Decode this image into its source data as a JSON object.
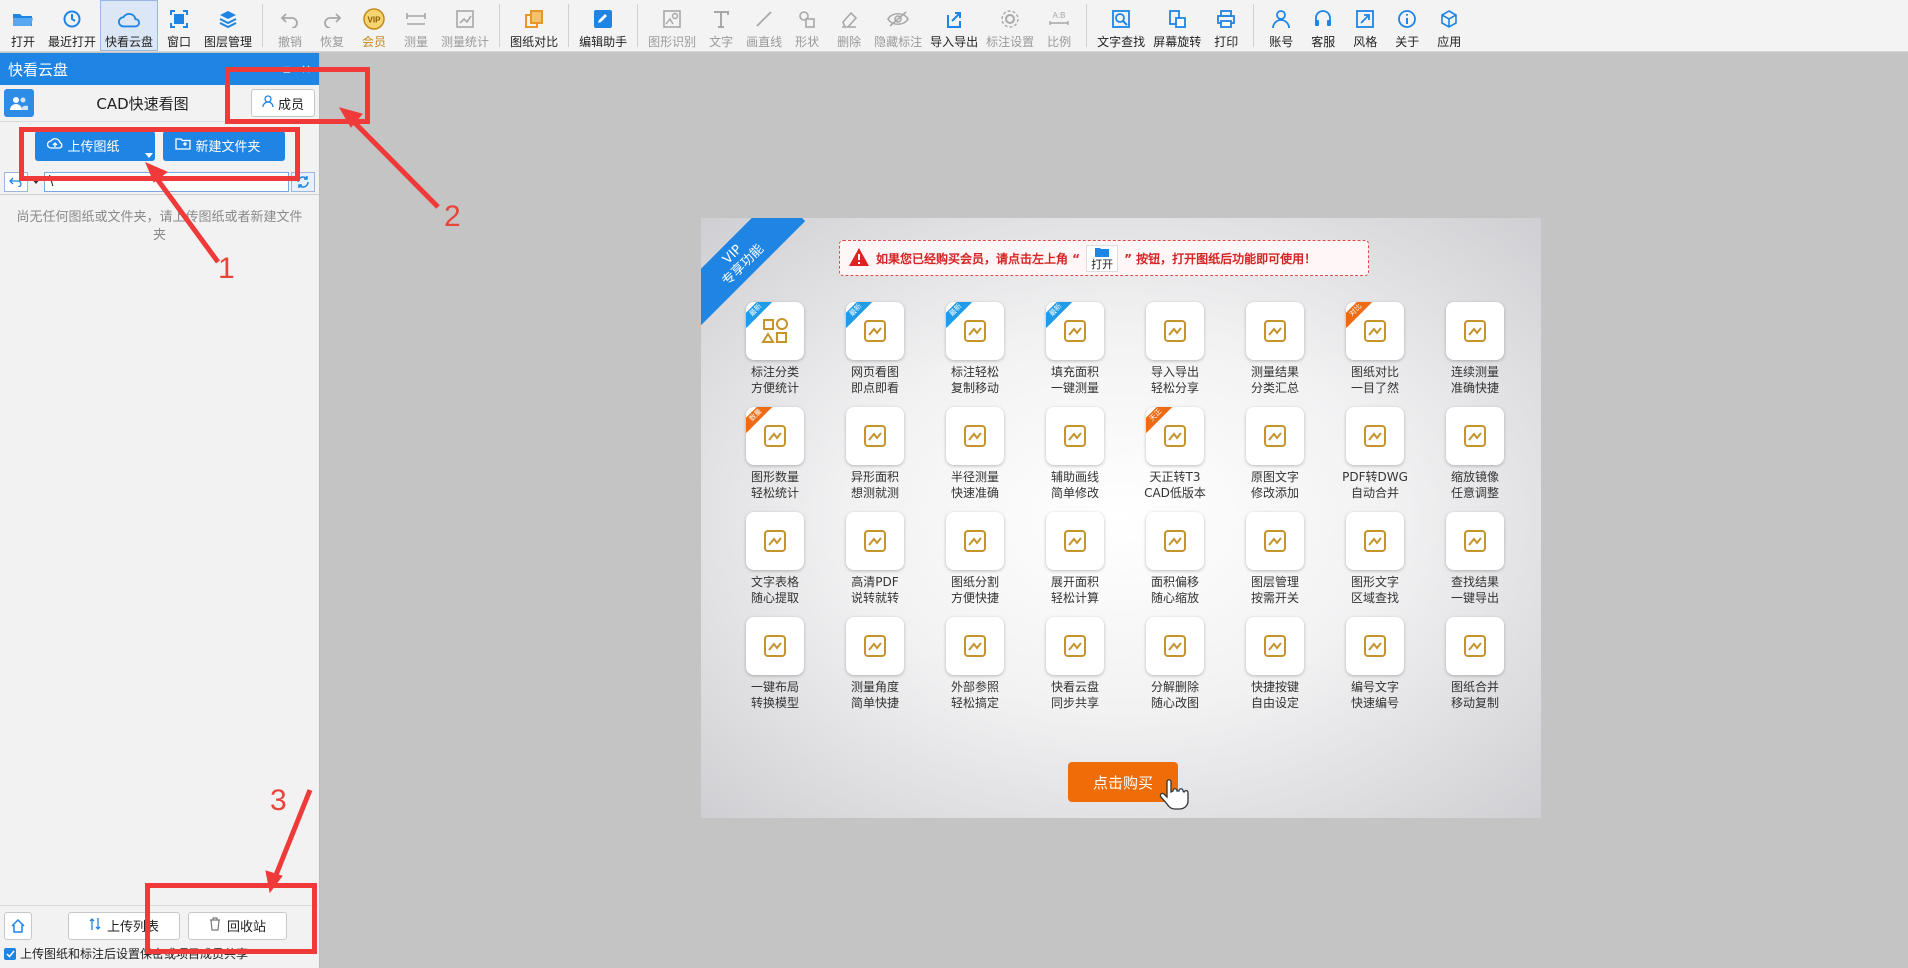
{
  "toolbar": {
    "items": [
      {
        "label": "打开",
        "icon": "open-folder-icon"
      },
      {
        "label": "最近打开",
        "icon": "recent-icon"
      },
      {
        "label": "快看云盘",
        "icon": "cloud-icon"
      },
      {
        "label": "窗口",
        "icon": "window-icon"
      },
      {
        "label": "图层管理",
        "icon": "layers-icon"
      },
      {
        "label": "撤销",
        "icon": "undo-icon"
      },
      {
        "label": "恢复",
        "icon": "redo-icon"
      },
      {
        "label": "会员",
        "icon": "vip-icon"
      },
      {
        "label": "测量",
        "icon": "measure-icon"
      },
      {
        "label": "测量统计",
        "icon": "measure-stats-icon"
      },
      {
        "label": "图纸对比",
        "icon": "compare-icon"
      },
      {
        "label": "编辑助手",
        "icon": "edit-assistant-icon"
      },
      {
        "label": "图形识别",
        "icon": "shape-recognize-icon"
      },
      {
        "label": "文字",
        "icon": "text-icon"
      },
      {
        "label": "画直线",
        "icon": "line-icon"
      },
      {
        "label": "形状",
        "icon": "shape-icon"
      },
      {
        "label": "删除",
        "icon": "eraser-icon"
      },
      {
        "label": "隐藏标注",
        "icon": "hide-icon"
      },
      {
        "label": "导入导出",
        "icon": "import-export-icon"
      },
      {
        "label": "标注设置",
        "icon": "annotation-settings-icon"
      },
      {
        "label": "比例",
        "icon": "scale-icon"
      },
      {
        "label": "文字查找",
        "icon": "text-search-icon"
      },
      {
        "label": "屏幕旋转",
        "icon": "rotate-icon"
      },
      {
        "label": "打印",
        "icon": "print-icon"
      },
      {
        "label": "账号",
        "icon": "account-icon"
      },
      {
        "label": "客服",
        "icon": "headset-icon"
      },
      {
        "label": "风格",
        "icon": "style-icon"
      },
      {
        "label": "关于",
        "icon": "info-icon"
      },
      {
        "label": "应用",
        "icon": "app-cube-icon"
      }
    ]
  },
  "panel": {
    "header_title": "快看云盘",
    "title": "CAD快速看图",
    "member_label": "成员",
    "upload_label": "上传图纸",
    "new_folder_label": "新建文件夹",
    "path_value": "\\",
    "empty_text": "尚无任何图纸或文件夹，请上传图纸或者新建文件夹",
    "upload_list_label": "上传列表",
    "recycle_label": "回收站",
    "checkbox_text": "上传图纸和标注后设置保密或项目成员共享"
  },
  "annotations": {
    "n1": "1",
    "n2": "2",
    "n3": "3"
  },
  "promo": {
    "ribbon": "VIP\n专享功能",
    "notice_pre": "如果您已经购买会员，请点击左上角 “",
    "notice_open": "打开",
    "notice_post": "” 按钮，打开图纸后功能即可使用！",
    "buy_label": "点击购买",
    "features": [
      {
        "label": "标注分类\n方便统计",
        "tag": "最新",
        "tag_color": "blue",
        "icon": "shapes-icon"
      },
      {
        "label": "网页看图\n即点即看",
        "tag": "最新",
        "tag_color": "blue",
        "icon": "webpage-icon"
      },
      {
        "label": "标注轻松\n复制移动",
        "tag": "最新",
        "tag_color": "blue",
        "icon": "move-icon"
      },
      {
        "label": "填充面积\n一键测量",
        "tag": "最新",
        "tag_color": "blue",
        "icon": "fill-area-icon"
      },
      {
        "label": "导入导出\n轻松分享",
        "tag": "",
        "tag_color": "",
        "icon": "export-share-icon"
      },
      {
        "label": "测量结果\n分类汇总",
        "tag": "",
        "tag_color": "",
        "icon": "chart-summary-icon"
      },
      {
        "label": "图纸对比\n一目了然",
        "tag": "对比",
        "tag_color": "orange",
        "icon": "compare-icon"
      },
      {
        "label": "连续测量\n准确快捷",
        "tag": "",
        "tag_color": "",
        "icon": "continuous-measure-icon"
      },
      {
        "label": "图形数量\n轻松统计",
        "tag": "数量",
        "tag_color": "orange",
        "icon": "shape-count-icon"
      },
      {
        "label": "异形面积\n想测就测",
        "tag": "",
        "tag_color": "",
        "icon": "irregular-area-icon"
      },
      {
        "label": "半径测量\n快速准确",
        "tag": "",
        "tag_color": "",
        "icon": "radius-icon"
      },
      {
        "label": "辅助画线\n简单修改",
        "tag": "",
        "tag_color": "",
        "icon": "draw-line-icon"
      },
      {
        "label": "天正转T3\nCAD低版本",
        "tag": "天正",
        "tag_color": "orange",
        "icon": "convert-icon"
      },
      {
        "label": "原图文字\n修改添加",
        "tag": "",
        "tag_color": "",
        "icon": "pen-icon"
      },
      {
        "label": "PDF转DWG\n自动合并",
        "tag": "",
        "tag_color": "",
        "icon": "pdf-dwg-icon"
      },
      {
        "label": "缩放镜像\n任意调整",
        "tag": "",
        "tag_color": "",
        "icon": "mirror-icon"
      },
      {
        "label": "文字表格\n随心提取",
        "tag": "",
        "tag_color": "",
        "icon": "table-icon"
      },
      {
        "label": "高清PDF\n说转就转",
        "tag": "",
        "tag_color": "",
        "icon": "pdf-icon"
      },
      {
        "label": "图纸分割\n方便快捷",
        "tag": "",
        "tag_color": "",
        "icon": "split-icon"
      },
      {
        "label": "展开面积\n轻松计算",
        "tag": "",
        "tag_color": "",
        "icon": "cube-area-icon"
      },
      {
        "label": "面积偏移\n随心缩放",
        "tag": "",
        "tag_color": "",
        "icon": "area-offset-icon"
      },
      {
        "label": "图层管理\n按需开关",
        "tag": "",
        "tag_color": "",
        "icon": "layers-icon"
      },
      {
        "label": "图形文字\n区域查找",
        "tag": "",
        "tag_color": "",
        "icon": "area-search-icon"
      },
      {
        "label": "查找结果\n一键导出",
        "tag": "",
        "tag_color": "",
        "icon": "export-result-icon"
      },
      {
        "label": "一键布局\n转换模型",
        "tag": "",
        "tag_color": "",
        "icon": "layout-cloud-icon"
      },
      {
        "label": "测量角度\n简单快捷",
        "tag": "",
        "tag_color": "",
        "icon": "angle-icon"
      },
      {
        "label": "外部参照\n轻松搞定",
        "tag": "",
        "tag_color": "",
        "icon": "dwg-ref-icon"
      },
      {
        "label": "快看云盘\n同步共享",
        "tag": "",
        "tag_color": "",
        "icon": "cloud-sync-icon"
      },
      {
        "label": "分解删除\n随心改图",
        "tag": "",
        "tag_color": "",
        "icon": "explode-icon"
      },
      {
        "label": "快捷按键\n自由设定",
        "tag": "",
        "tag_color": "",
        "icon": "keyboard-icon"
      },
      {
        "label": "编号文字\n快速编号",
        "tag": "",
        "tag_color": "",
        "icon": "numbering-icon"
      },
      {
        "label": "图纸合并\n移动复制",
        "tag": "",
        "tag_color": "",
        "icon": "merge-move-icon"
      }
    ]
  }
}
